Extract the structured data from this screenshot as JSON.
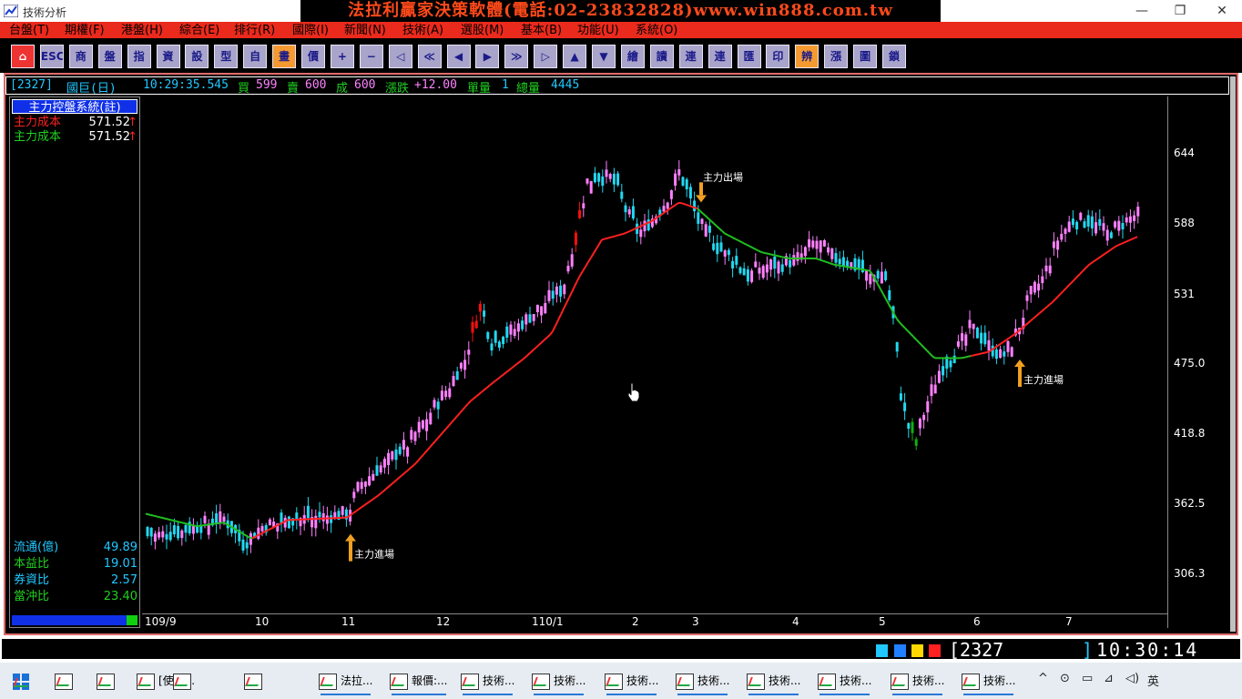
{
  "window": {
    "title": "技術分析",
    "banner": "法拉利贏家決策軟體(電話:02-23832828)www.win888.com.tw",
    "minimize": "—",
    "restore": "❐",
    "close": "✕"
  },
  "menu": [
    "台盤(T)",
    "期權(F)",
    "港盤(H)",
    "綜合(E)",
    "排行(R)",
    "國際(I)",
    "新聞(N)",
    "技術(A)",
    "選股(M)",
    "基本(B)",
    "功能(U)",
    "系統(O)"
  ],
  "toolbar": [
    "⌂",
    "ESC",
    "商",
    "盤",
    "指",
    "資",
    "設",
    "型",
    "自",
    "畫",
    "價",
    "+",
    "−",
    "◁",
    "≪",
    "◀",
    "▶",
    "≫",
    "▷",
    "▲",
    "▼",
    "繪",
    "讀",
    "連",
    "連",
    "匯",
    "印",
    "辨",
    "漲",
    "圖",
    "鎖"
  ],
  "infobar": {
    "code": "[2327]",
    "name": "國巨(日)",
    "time": "10:29:35.545",
    "buy_label": "買",
    "buy": "599",
    "sell_label": "賣",
    "sell": "600",
    "deal_label": "成",
    "deal": "600",
    "change_label": "漲跌",
    "change": "+12.00",
    "single_label": "單量",
    "single": "1",
    "total_label": "總量",
    "total": "4445"
  },
  "panel": {
    "title": "主力控盤系統(註)",
    "rows": [
      {
        "label": "主力成本",
        "value": "571.52",
        "arrow": "↑",
        "color": "#ff2020"
      },
      {
        "label": "主力成本",
        "value": "571.52",
        "arrow": "↑",
        "color": "#20d020"
      }
    ],
    "stats": [
      {
        "label": "流通(億)",
        "value": "49.89"
      },
      {
        "label": "本益比",
        "value": "19.01"
      },
      {
        "label": "券資比",
        "value": "2.57"
      },
      {
        "label": "當沖比",
        "value": "23.40"
      }
    ]
  },
  "chart_data": {
    "type": "candlestick",
    "stock": "2327 國巨",
    "ylim": [
      275,
      690
    ],
    "y_ticks": [
      "644",
      "588",
      "531",
      "475.0",
      "418.8",
      "362.5",
      "306.3"
    ],
    "x_ticks": [
      "109/9",
      "10",
      "11",
      "12",
      "110/1",
      "2",
      "3",
      "4",
      "5",
      "6",
      "7"
    ],
    "annotations": [
      {
        "text": "主力進場",
        "type": "buy",
        "date": "109/11",
        "price": 352
      },
      {
        "text": "主力出場",
        "type": "sell",
        "date": "110/3",
        "price": 605
      },
      {
        "text": "主力進場",
        "type": "buy",
        "date": "110/6",
        "price": 492
      }
    ],
    "colors": {
      "up": "#ff80ff",
      "down": "#22d8f0",
      "limit_up": "#ff1010",
      "limit_down": "#10b010",
      "cost_up": "#ff2020",
      "cost_down": "#20c020"
    }
  },
  "status": {
    "code": "[2327_",
    "bracket": "]",
    "clock": "10:30:14",
    "swatches": [
      "#20c8ff",
      "#2080ff",
      "#ffd800",
      "#ff2020"
    ]
  },
  "taskbar": {
    "items": [
      "",
      "",
      "",
      "[使用...",
      "",
      "",
      "法拉...",
      "報價:...",
      "技術...",
      "技術...",
      "技術...",
      "技術...",
      "技術...",
      "技術...",
      "技術...",
      "技術..."
    ],
    "tray_ime": "英",
    "tray_icons": [
      "^",
      "⊙",
      "▭",
      "⊿",
      "◁)"
    ]
  }
}
